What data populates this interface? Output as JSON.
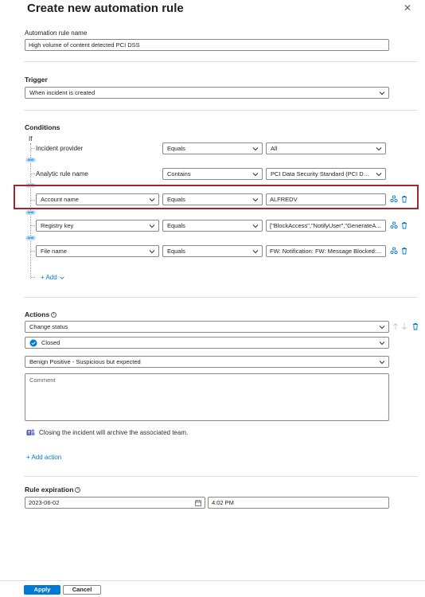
{
  "panel": {
    "title": "Create new automation rule",
    "close_glyph": "✕"
  },
  "rule_name": {
    "label": "Automation rule name",
    "value": "High volume of content detected PCI DSS"
  },
  "trigger": {
    "heading": "Trigger",
    "value": "When incident is created"
  },
  "conditions": {
    "heading": "Conditions",
    "if_label": "If",
    "and_label": "AND",
    "rows": [
      {
        "property": "Incident provider",
        "operator": "Equals",
        "value": "All"
      },
      {
        "property": "Analytic rule name",
        "operator": "Contains",
        "value": "PCI Data Security Standard (PCI DSS)"
      },
      {
        "property": "Account name",
        "operator": "Equals",
        "value": "ALFREDV"
      },
      {
        "property": "Registry key",
        "operator": "Equals",
        "value": "[\"BlockAccess\",\"NotifyUser\",\"GenerateA..."
      },
      {
        "property": "File name",
        "operator": "Equals",
        "value": "FW: Notification: FW: Message Blocked:..."
      }
    ],
    "add_label": "+ Add"
  },
  "actions": {
    "heading": "Actions",
    "action_value": "Change status",
    "status_value": "Closed",
    "reason_value": "Benign Positive - Suspicious but expected",
    "comment_placeholder": "Comment",
    "teams_note": "Closing the incident will archive the associated team.",
    "add_action_label": "+ Add action"
  },
  "expiration": {
    "heading": "Rule expiration",
    "date": "2023-06-02",
    "time": "4:02 PM"
  },
  "footer": {
    "apply_label": "Apply",
    "cancel_label": "Cancel"
  },
  "colors": {
    "accent": "#0078d4",
    "highlight": "#a4262c",
    "and_badge_bg": "#c7e0f4"
  },
  "icons": [
    "close-icon",
    "chevron-down-icon",
    "move-to-group-icon",
    "delete-icon",
    "info-icon",
    "checkmark-circle-icon",
    "teams-icon",
    "calendar-icon",
    "arrow-up-icon",
    "arrow-down-icon"
  ]
}
